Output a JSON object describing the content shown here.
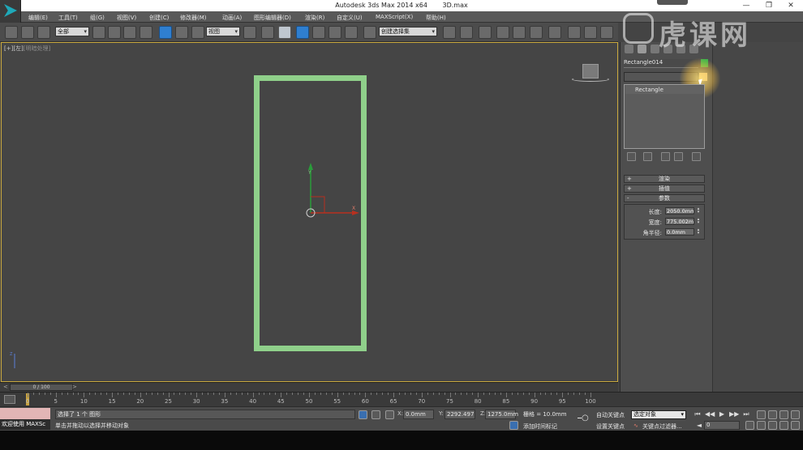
{
  "window": {
    "app_title": "Autodesk 3ds Max  2014 x64",
    "file_name": "3D.max",
    "minimize_icon": "minimize-icon",
    "maximize_icon": "maximize-icon",
    "close_icon": "close-icon"
  },
  "menu": [
    "编辑(E)",
    "工具(T)",
    "组(G)",
    "视图(V)",
    "创建(C)",
    "修改器(M)",
    "动画(A)",
    "图形编辑器(D)",
    "渲染(R)",
    "自定义(U)",
    "MAXScript(X)",
    "帮助(H)"
  ],
  "toolbar": {
    "selection_filter": "全部",
    "ref_coord": "视图",
    "named_selection": "创建选择集"
  },
  "watermark": "虎课网",
  "viewport": {
    "label": "[+][左]",
    "label_mode": "[明暗处理]",
    "axis_y": "Y",
    "axis_x": "X",
    "axis_z": "Z"
  },
  "command_panel": {
    "object_name": "Rectangle014",
    "object_color": "#3bb34a",
    "stack_item": "Rectangle",
    "rollouts": [
      {
        "sign": "+",
        "label": "渲染"
      },
      {
        "sign": "+",
        "label": "插值"
      },
      {
        "sign": "-",
        "label": "参数"
      }
    ],
    "params": [
      {
        "label": "长度:",
        "value": "2050.0mm"
      },
      {
        "label": "宽度:",
        "value": "775.002m"
      },
      {
        "label": "角半径:",
        "value": "0.0mm"
      }
    ]
  },
  "timeline": {
    "frame_display": "0 / 100",
    "prev_arrow": "<",
    "next_arrow": ">",
    "ticks": [
      "0",
      "5",
      "10",
      "15",
      "20",
      "25",
      "30",
      "35",
      "40",
      "45",
      "50",
      "55",
      "60",
      "65",
      "70",
      "75",
      "80",
      "85",
      "90",
      "95",
      "100"
    ]
  },
  "status": {
    "maxscript_label": "欢迎使用 MAXSc",
    "selected_text": "选择了 1 个 图形",
    "prompt_text": "单击并拖动以选择并移动对象",
    "x_label": "X:",
    "x_value": "0.0mm",
    "y_label": "Y:",
    "y_value": "2292.497",
    "z_label": "Z:",
    "z_value": "1275.0mm",
    "grid_text": "栅格 = 10.0mm",
    "add_time_tag": "添加时间标记",
    "auto_key": "自动关键点",
    "set_key": "设置关键点",
    "selection_set": "选定对象",
    "key_filters": "关键点过滤器...",
    "current_frame": "0"
  }
}
